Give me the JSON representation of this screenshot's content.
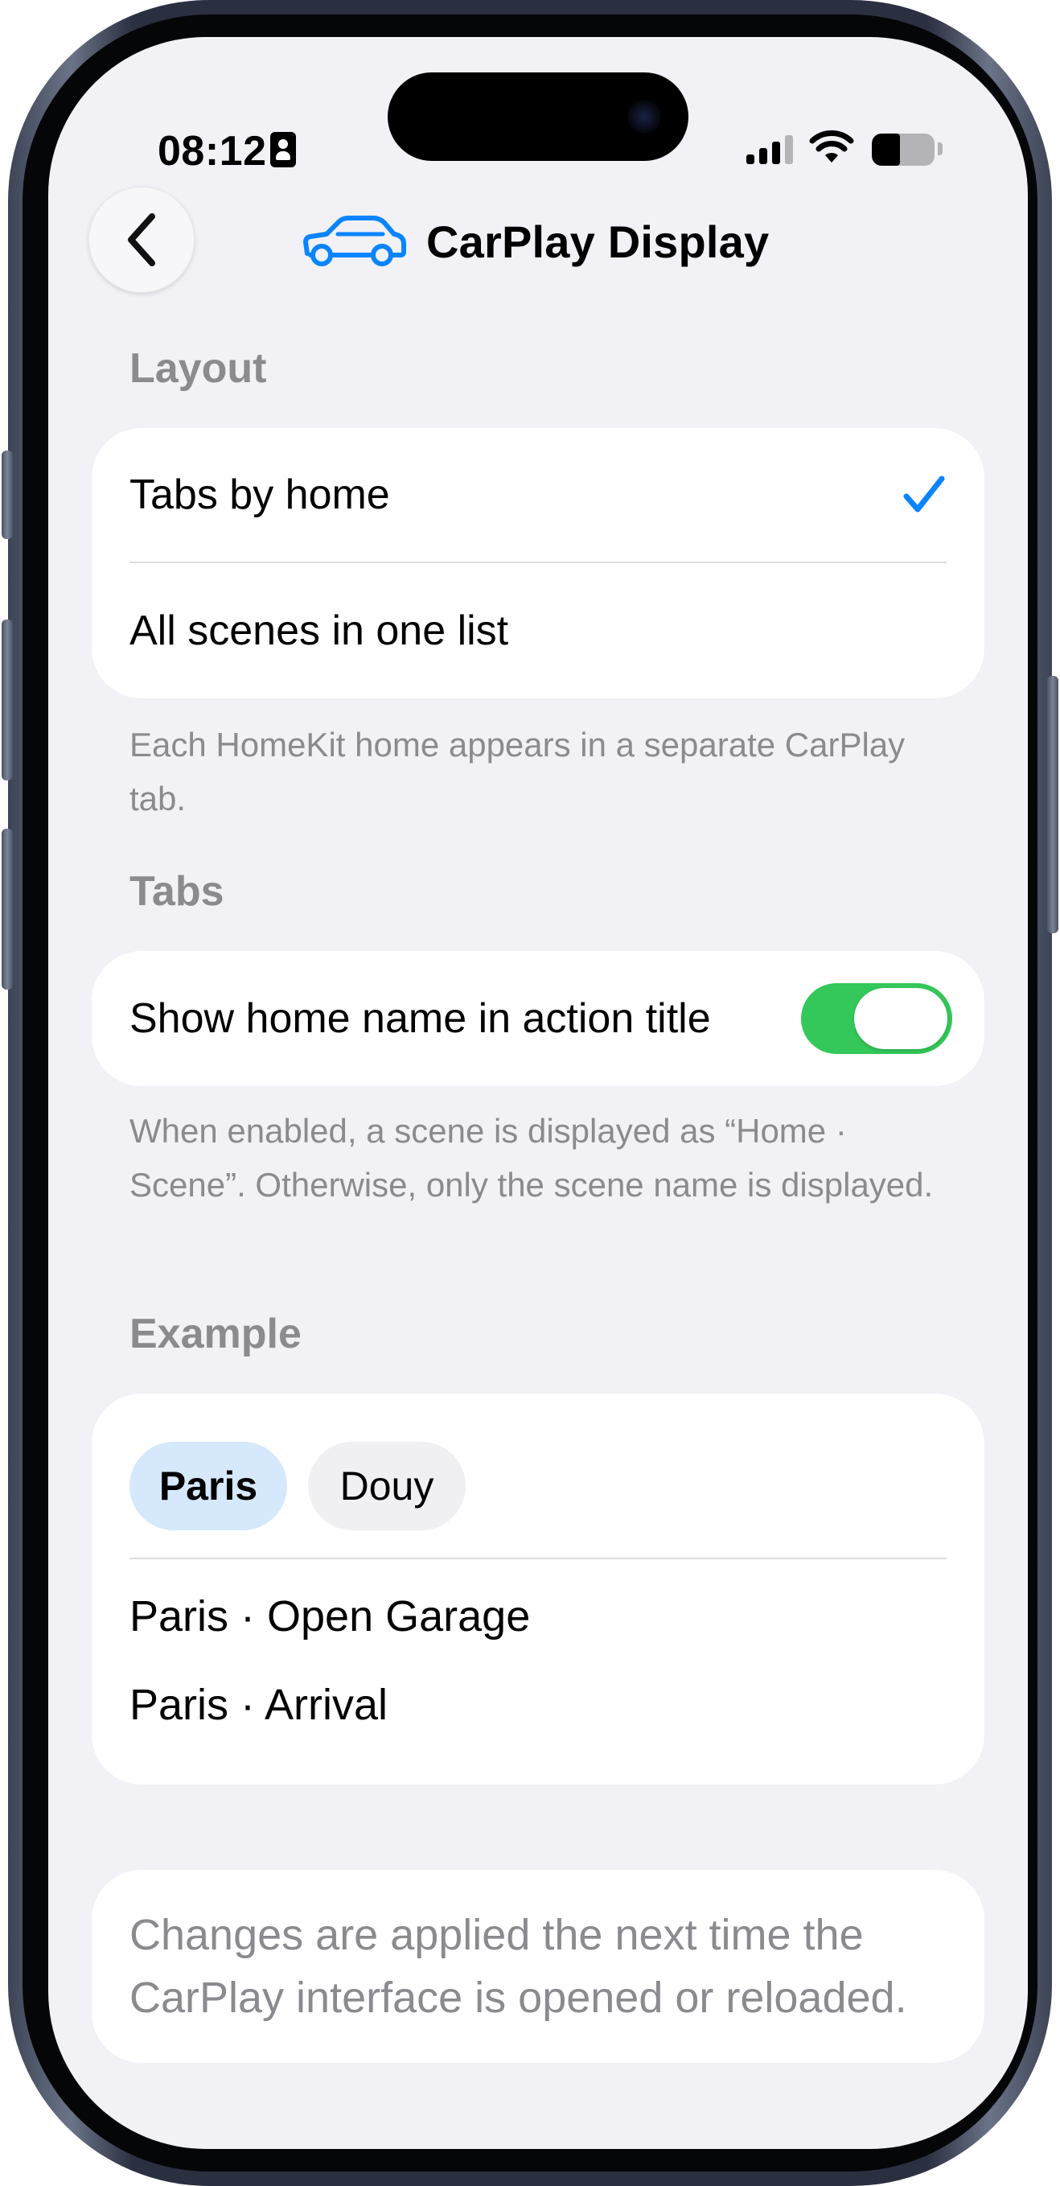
{
  "status_bar": {
    "time": "08:12",
    "battery_level": 0.45
  },
  "nav": {
    "title": "CarPlay Display",
    "back_icon": "chevron-left-icon",
    "title_icon": "car-icon"
  },
  "layout_section": {
    "header": "Layout",
    "options": [
      {
        "label": "Tabs by home",
        "selected": true
      },
      {
        "label": "All scenes in one list",
        "selected": false
      }
    ],
    "footnote": "Each HomeKit home appears in a separate CarPlay tab."
  },
  "tabs_section": {
    "header": "Tabs",
    "toggle_label": "Show home name in action title",
    "toggle_on": true,
    "footnote": "When enabled, a scene is displayed as “Home · Scene”. Otherwise, only the scene name is displayed."
  },
  "example_section": {
    "header": "Example",
    "chips": [
      {
        "label": "Paris",
        "selected": true
      },
      {
        "label": "Douy",
        "selected": false
      }
    ],
    "items": [
      "Paris · Open Garage",
      "Paris · Arrival"
    ]
  },
  "notice": {
    "text": "Changes are applied the next time the CarPlay interface is opened or reloaded."
  },
  "colors": {
    "accent": "#0a84ff",
    "toggle_on": "#34c759",
    "background": "#f1f1f6",
    "secondary_text": "#8a8a8f",
    "chip_selected": "#d6e8fb"
  }
}
